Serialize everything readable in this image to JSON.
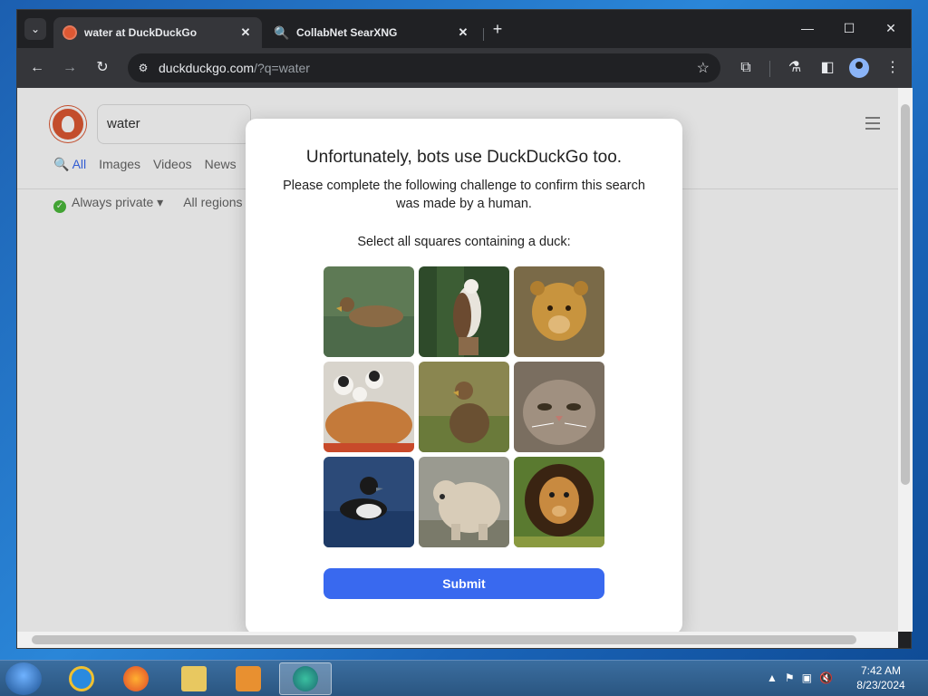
{
  "tabs": [
    {
      "title": "water at DuckDuckGo",
      "active": true
    },
    {
      "title": "CollabNet SearXNG",
      "active": false
    }
  ],
  "omnibox": {
    "host": "duckduckgo.com",
    "path": "/?q=water"
  },
  "ddg": {
    "search_value": "water",
    "nav_tabs": [
      "All",
      "Images",
      "Videos",
      "News"
    ],
    "filter_private": "Always private",
    "filter_region": "All regions"
  },
  "challenge": {
    "title": "Unfortunately, bots use DuckDuckGo too.",
    "subtitle": "Please complete the following challenge to confirm this search was made by a human.",
    "prompt": "Select all squares containing a duck:",
    "tiles": [
      {
        "subject": "duck-on-water"
      },
      {
        "subject": "eagle"
      },
      {
        "subject": "lion-cub"
      },
      {
        "subject": "puppies-and-cat"
      },
      {
        "subject": "duck-in-grass"
      },
      {
        "subject": "cat-closeup"
      },
      {
        "subject": "diving-duck"
      },
      {
        "subject": "bear"
      },
      {
        "subject": "lion"
      }
    ],
    "submit_label": "Submit"
  },
  "taskbar": {
    "time": "7:42 AM",
    "date": "8/23/2024"
  }
}
